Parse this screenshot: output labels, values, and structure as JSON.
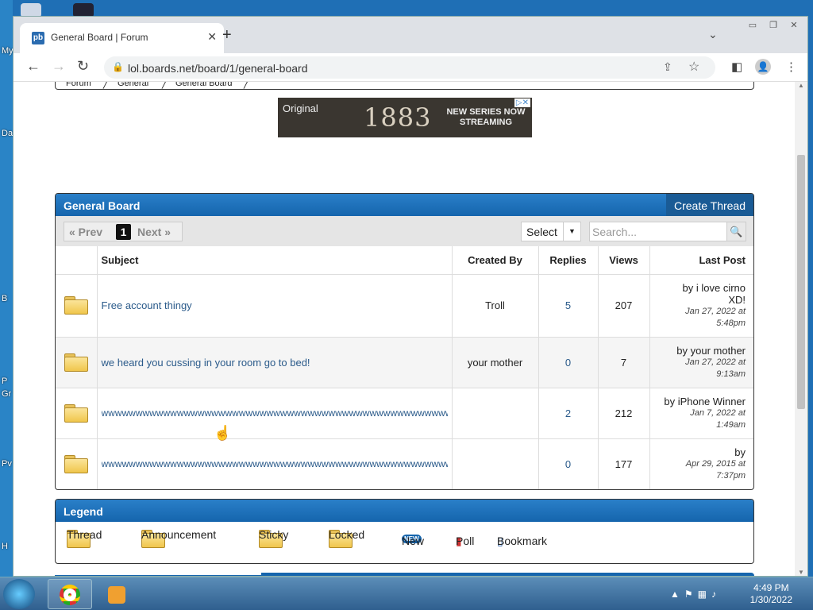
{
  "desktop": {
    "labels": [
      "My",
      "Da",
      "B",
      "P",
      "Gr",
      "Pv",
      "H"
    ]
  },
  "browser": {
    "tab_title": "General Board | Forum",
    "favicon_text": "pb",
    "url": "lol.boards.net/board/1/general-board",
    "window_controls": [
      "minimize",
      "restore",
      "close"
    ]
  },
  "breadcrumb": [
    "Forum",
    "General",
    "General Board"
  ],
  "ad": {
    "brand": "Original",
    "title": "1883",
    "tagline": "NEW SERIES NOW STREAMING"
  },
  "board": {
    "title": "General Board",
    "create_label": "Create Thread",
    "pager": {
      "prev": "« Prev",
      "current": "1",
      "next": "Next »"
    },
    "select_label": "Select",
    "search_placeholder": "Search...",
    "columns": [
      "Subject",
      "Created By",
      "Replies",
      "Views",
      "Last Post"
    ],
    "threads": [
      {
        "subject": "Free account thingy",
        "created_by": "Troll",
        "replies": "5",
        "views": "207",
        "last_by": "by i love cirno XD!",
        "last_date": "Jan 27, 2022 at 5:48pm"
      },
      {
        "subject": "we heard you cussing in your room go to bed!",
        "created_by": "your mother",
        "replies": "0",
        "views": "7",
        "last_by": "by your mother",
        "last_date": "Jan 27, 2022 at 9:13am"
      },
      {
        "subject": "wwwwwwwwwwwwwwwwwwwwwwwwwwwwwwwwwwwwwwwwwwwwwwwwwwwwwwwwwwwwwwww",
        "created_by": "",
        "replies": "2",
        "views": "212",
        "last_by": "by iPhone Winner",
        "last_date": "Jan 7, 2022 at 1:49am"
      },
      {
        "subject": "wwwwwwwwwwwwwwwwwwwwwwwwwwwwwwwwwwwwwwwwwwwwwwwwwwwwwwwwwwwwwwww",
        "created_by": "",
        "replies": "0",
        "views": "177",
        "last_by": "by",
        "last_date": "Apr 29, 2015 at 7:37pm"
      }
    ]
  },
  "legend": {
    "title": "Legend",
    "items": [
      "Thread",
      "Announcement",
      "Sticky",
      "Locked",
      "New",
      "Poll",
      "Bookmark"
    ],
    "new_badge": "NEW"
  },
  "taskbar": {
    "time": "4:49 PM",
    "date": "1/30/2022"
  }
}
